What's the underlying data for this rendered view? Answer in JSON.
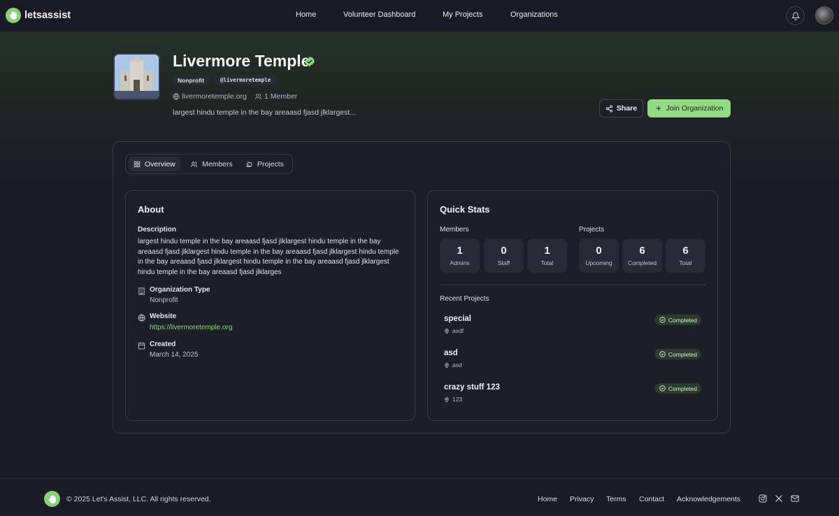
{
  "brand": {
    "name": "letsassist",
    "accent": "#94d986"
  },
  "nav": {
    "links": [
      "Home",
      "Volunteer Dashboard",
      "My Projects",
      "Organizations"
    ]
  },
  "org": {
    "name": "Livermore Temple",
    "type_tag": "Nonprofit",
    "handle": "@livermoretemple",
    "website_short": "livermoretemple.org",
    "member_count": "1 Member",
    "short_description": "largest hindu temple in the bay areaasd fjasd jlklargest..."
  },
  "actions": {
    "share": "Share",
    "join": "Join Organization"
  },
  "tabs": [
    "Overview",
    "Members",
    "Projects"
  ],
  "about": {
    "title": "About",
    "description_label": "Description",
    "description": "largest hindu temple in the bay areaasd fjasd jlklargest hindu temple in the bay areaasd fjasd jlklargest hindu temple in the bay areaasd fjasd jlklargest hindu temple in the bay areaasd fjasd jlklargest hindu temple in the bay areaasd fjasd jlklargest hindu temple in the bay areaasd fjasd jlklarges",
    "type_label": "Organization Type",
    "type_value": "Nonprofit",
    "website_label": "Website",
    "website_value": "https://livermoretemple.org",
    "created_label": "Created",
    "created_value": "March 14, 2025"
  },
  "stats": {
    "title": "Quick Stats",
    "members_label": "Members",
    "projects_label": "Projects",
    "members": [
      {
        "num": "1",
        "label": "Admins"
      },
      {
        "num": "0",
        "label": "Staff"
      },
      {
        "num": "1",
        "label": "Total"
      }
    ],
    "projects": [
      {
        "num": "0",
        "label": "Upcoming"
      },
      {
        "num": "6",
        "label": "Completed"
      },
      {
        "num": "6",
        "label": "Total"
      }
    ],
    "recent_label": "Recent Projects",
    "recent": [
      {
        "name": "special",
        "location": "asdf",
        "status": "Completed"
      },
      {
        "name": "asd",
        "location": "asd",
        "status": "Completed"
      },
      {
        "name": "crazy stuff 123",
        "location": "123",
        "status": "Completed"
      }
    ]
  },
  "footer": {
    "copyright": "© 2025 Let's Assist, LLC. All rights reserved.",
    "links": [
      "Home",
      "Privacy",
      "Terms",
      "Contact",
      "Acknowledgements"
    ],
    "social_icons": [
      "instagram-icon",
      "x-icon",
      "mail-icon"
    ]
  }
}
